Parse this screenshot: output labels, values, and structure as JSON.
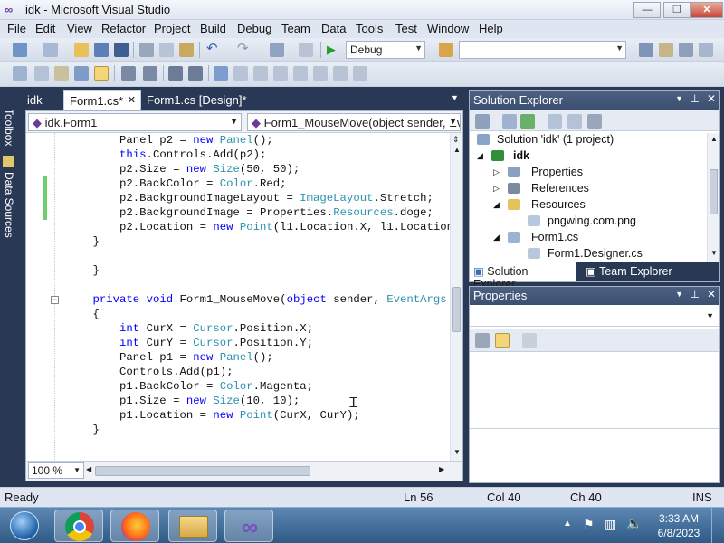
{
  "window": {
    "title": "idk - Microsoft Visual Studio",
    "min_glyph": "—",
    "max_glyph": "❐",
    "close_glyph": "✕"
  },
  "menu": [
    "File",
    "Edit",
    "View",
    "Refactor",
    "Project",
    "Build",
    "Debug",
    "Team",
    "Data",
    "Tools",
    "Test",
    "Window",
    "Help"
  ],
  "toolbar": {
    "config_value": "Debug",
    "search_value": ""
  },
  "tabs": [
    {
      "label": "idk"
    },
    {
      "label": "Form1.cs*",
      "close": "✕"
    },
    {
      "label": "Form1.cs [Design]*"
    }
  ],
  "side_tabs": [
    "Toolbox",
    "Data Sources"
  ],
  "editor": {
    "class_combo": "idk.Form1",
    "member_combo": "Form1_MouseMove(object sender, Eve",
    "zoom": "100 %",
    "lines": [
      [
        {
          "t": "        Panel p2 = "
        },
        {
          "t": "new",
          "c": "kw"
        },
        {
          "t": " "
        },
        {
          "t": "Panel",
          "c": "ty"
        },
        {
          "t": "();"
        }
      ],
      [
        {
          "t": "        "
        },
        {
          "t": "this",
          "c": "kw"
        },
        {
          "t": ".Controls.Add(p2);"
        }
      ],
      [
        {
          "t": "        p2.Size = "
        },
        {
          "t": "new",
          "c": "kw"
        },
        {
          "t": " "
        },
        {
          "t": "Size",
          "c": "ty"
        },
        {
          "t": "(50, 50);"
        }
      ],
      [
        {
          "t": "        p2.BackColor = "
        },
        {
          "t": "Color",
          "c": "ty"
        },
        {
          "t": ".Red;"
        }
      ],
      [
        {
          "t": "        p2.BackgroundImageLayout = "
        },
        {
          "t": "ImageLayout",
          "c": "ty"
        },
        {
          "t": ".Stretch;"
        }
      ],
      [
        {
          "t": "        p2.BackgroundImage = Properties."
        },
        {
          "t": "Resources",
          "c": "ty"
        },
        {
          "t": ".doge;"
        }
      ],
      [
        {
          "t": "        p2.Location = "
        },
        {
          "t": "new",
          "c": "kw"
        },
        {
          "t": " "
        },
        {
          "t": "Point",
          "c": "ty"
        },
        {
          "t": "(l1.Location.X, l1.Location"
        }
      ],
      [
        {
          "t": "    }"
        }
      ],
      [
        {
          "t": ""
        }
      ],
      [
        {
          "t": "    }"
        }
      ],
      [
        {
          "t": ""
        }
      ],
      [
        {
          "t": "    "
        },
        {
          "t": "private",
          "c": "kw"
        },
        {
          "t": " "
        },
        {
          "t": "void",
          "c": "kw"
        },
        {
          "t": " Form1_MouseMove("
        },
        {
          "t": "object",
          "c": "kw"
        },
        {
          "t": " sender, "
        },
        {
          "t": "EventArgs",
          "c": "ty"
        }
      ],
      [
        {
          "t": "    {"
        }
      ],
      [
        {
          "t": "        "
        },
        {
          "t": "int",
          "c": "kw"
        },
        {
          "t": " CurX = "
        },
        {
          "t": "Cursor",
          "c": "ty"
        },
        {
          "t": ".Position.X;"
        }
      ],
      [
        {
          "t": "        "
        },
        {
          "t": "int",
          "c": "kw"
        },
        {
          "t": " CurY = "
        },
        {
          "t": "Cursor",
          "c": "ty"
        },
        {
          "t": ".Position.Y;"
        }
      ],
      [
        {
          "t": "        Panel p1 = "
        },
        {
          "t": "new",
          "c": "kw"
        },
        {
          "t": " "
        },
        {
          "t": "Panel",
          "c": "ty"
        },
        {
          "t": "();"
        }
      ],
      [
        {
          "t": "        Controls.Add(p1);"
        }
      ],
      [
        {
          "t": "        p1.BackColor = "
        },
        {
          "t": "Color",
          "c": "ty"
        },
        {
          "t": ".Magenta;"
        }
      ],
      [
        {
          "t": "        p1.Size = "
        },
        {
          "t": "new",
          "c": "kw"
        },
        {
          "t": " "
        },
        {
          "t": "Size",
          "c": "ty"
        },
        {
          "t": "(10, 10);"
        }
      ],
      [
        {
          "t": "        p1.Location = "
        },
        {
          "t": "new",
          "c": "kw"
        },
        {
          "t": " "
        },
        {
          "t": "Point",
          "c": "ty"
        },
        {
          "t": "(CurX, CurY);"
        }
      ],
      [
        {
          "t": "    }"
        }
      ]
    ]
  },
  "solution_explorer": {
    "title": "Solution Explorer",
    "items": [
      {
        "label": "Solution 'idk' (1 project)",
        "expander": ""
      },
      {
        "label": "idk",
        "expander": "◢",
        "bold": true
      },
      {
        "label": "Properties",
        "expander": "▷"
      },
      {
        "label": "References",
        "expander": "▷"
      },
      {
        "label": "Resources",
        "expander": "◢"
      },
      {
        "label": "pngwing.com.png",
        "expander": ""
      },
      {
        "label": "Form1.cs",
        "expander": "◢"
      },
      {
        "label": "Form1.Designer.cs",
        "expander": ""
      }
    ],
    "tab_solution": "Solution Explorer",
    "tab_team": "Team Explorer"
  },
  "properties": {
    "title": "Properties"
  },
  "status": {
    "state": "Ready",
    "ln": "Ln 56",
    "col": "Col 40",
    "ch": "Ch 40",
    "mode": "INS"
  },
  "taskbar": {
    "time": "3:33 AM",
    "date": "6/8/2023",
    "apps": [
      "start-orb",
      "chrome",
      "firefox",
      "file-explorer",
      "visual-studio"
    ]
  },
  "colors": {
    "keyword": "#0000ff",
    "type": "#2b91af",
    "change_marker": "#6ccf6c",
    "pane_header": "#4d6082"
  }
}
